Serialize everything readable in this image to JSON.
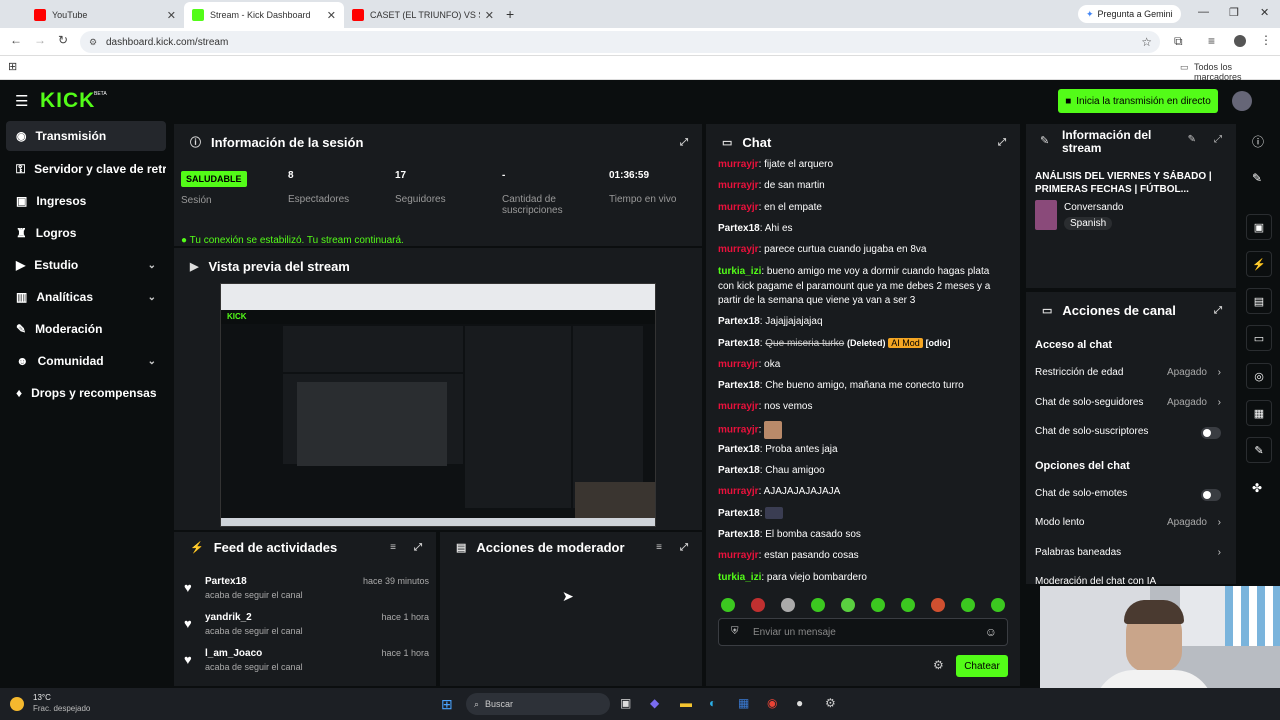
{
  "browser": {
    "tabs": [
      {
        "title": "YouTube"
      },
      {
        "title": "Stream - Kick Dashboard"
      },
      {
        "title": "CASET (EL TRIUNFO) VS SAN M"
      }
    ],
    "gemini_label": "Pregunta a Gemini",
    "url": "dashboard.kick.com/stream",
    "bookmarks_label": "Todos los marcadores"
  },
  "topnav": {
    "logo": "KICK",
    "logo_sup": "BETA",
    "go_live_label": "Inicia la transmisión en directo"
  },
  "sidebar": {
    "items": [
      {
        "label": "Transmisión",
        "icon": "broadcast-icon"
      },
      {
        "label": "Servidor y clave de retransmisión",
        "icon": "key-icon"
      },
      {
        "label": "Ingresos",
        "icon": "wallet-icon"
      },
      {
        "label": "Logros",
        "icon": "trophy-icon"
      },
      {
        "label": "Estudio",
        "icon": "video-icon"
      },
      {
        "label": "Analíticas",
        "icon": "chart-icon"
      },
      {
        "label": "Moderación",
        "icon": "wrench-icon"
      },
      {
        "label": "Comunidad",
        "icon": "people-icon"
      },
      {
        "label": "Drops y recompensas",
        "icon": "gift-icon"
      }
    ]
  },
  "session": {
    "title": "Información de la sesión",
    "status_badge": "SALUDABLE",
    "status_label": "Sesión",
    "stats": [
      {
        "value": "8",
        "label": "Espectadores"
      },
      {
        "value": "17",
        "label": "Seguidores"
      },
      {
        "value": "-",
        "label": "Cantidad de suscripciones"
      },
      {
        "value": "01:36:59",
        "label": "Tiempo en vivo"
      }
    ],
    "connection_msg": "Tu conexión se estabilizó. Tu stream continuará."
  },
  "preview": {
    "title": "Vista previa del stream"
  },
  "activity": {
    "title": "Feed de actividades",
    "items": [
      {
        "name": "Partex18",
        "action": "acaba de seguir el canal",
        "time": "hace 39 minutos"
      },
      {
        "name": "yandrik_2",
        "action": "acaba de seguir el canal",
        "time": "hace 1 hora"
      },
      {
        "name": "l_am_Joaco",
        "action": "acaba de seguir el canal",
        "time": "hace 1 hora"
      }
    ]
  },
  "mod_actions": {
    "title": "Acciones de moderador"
  },
  "chat": {
    "title": "Chat",
    "messages": [
      {
        "user": "murrayjr",
        "text": "fijate el arquero"
      },
      {
        "user": "murrayjr",
        "text": "de san martin"
      },
      {
        "user": "murrayjr",
        "text": "en el empate"
      },
      {
        "user": "Partex18",
        "text": "Ahi es"
      },
      {
        "user": "murrayjr",
        "text": "parece curtua cuando jugaba en 8va"
      },
      {
        "user": "turkia_izi",
        "text": "bueno amigo me voy a dormir cuando hagas plata con kick pagame el paramount que ya me debes 2 meses y a partir de la semana que viene ya van a ser 3"
      },
      {
        "user": "Partex18",
        "text": "Jajajjajajajaq"
      },
      {
        "user": "Partex18",
        "text": "Que miseria turko",
        "deleted": "(Deleted)",
        "tag": "AI Mod",
        "reason": "[odio]"
      },
      {
        "user": "murrayjr",
        "text": "oka"
      },
      {
        "user": "Partex18",
        "text": "Che bueno amigo, mañana me conecto turro"
      },
      {
        "user": "murrayjr",
        "text": "nos vemos"
      },
      {
        "user": "murrayjr",
        "text": ""
      },
      {
        "user": "Partex18",
        "text": "Proba antes jaja"
      },
      {
        "user": "Partex18",
        "text": "Chau amigoo"
      },
      {
        "user": "murrayjr",
        "text": "AJAJAJAJAJAJA"
      },
      {
        "user": "Partex18",
        "text": ""
      },
      {
        "user": "Partex18",
        "text": "El bomba casado sos"
      },
      {
        "user": "murrayjr",
        "text": "estan pasando cosas"
      },
      {
        "user": "turkia_izi",
        "text": "para viejo bombardero"
      }
    ],
    "input_placeholder": "Enviar un mensaje",
    "send_label": "Chatear"
  },
  "stream_info": {
    "title": "Información del stream",
    "stream_title": "ANÁLISIS DEL VIERNES Y SÁBADO | PRIMERAS FECHAS | FÚTBOL...",
    "category": "Conversando",
    "language": "Spanish"
  },
  "channel_actions": {
    "title": "Acciones de canal",
    "section1": "Acceso al chat",
    "rows1": [
      {
        "label": "Restricción de edad",
        "value": "Apagado"
      },
      {
        "label": "Chat de solo-seguidores",
        "value": "Apagado"
      },
      {
        "label": "Chat de solo-suscriptores",
        "value": ""
      }
    ],
    "section2": "Opciones del chat",
    "rows2": [
      {
        "label": "Chat de solo-emotes",
        "value": ""
      },
      {
        "label": "Modo lento",
        "value": "Apagado"
      },
      {
        "label": "Palabras baneadas",
        "value": ""
      },
      {
        "label": "Moderación del chat con IA",
        "value": ""
      }
    ]
  },
  "taskbar": {
    "temp": "13°C",
    "weather": "Frac. despejado",
    "search_placeholder": "Buscar"
  },
  "colors": {
    "accent": "#53fc18",
    "mod_red": "#e9113c",
    "ai_mod": "#f5a623"
  }
}
